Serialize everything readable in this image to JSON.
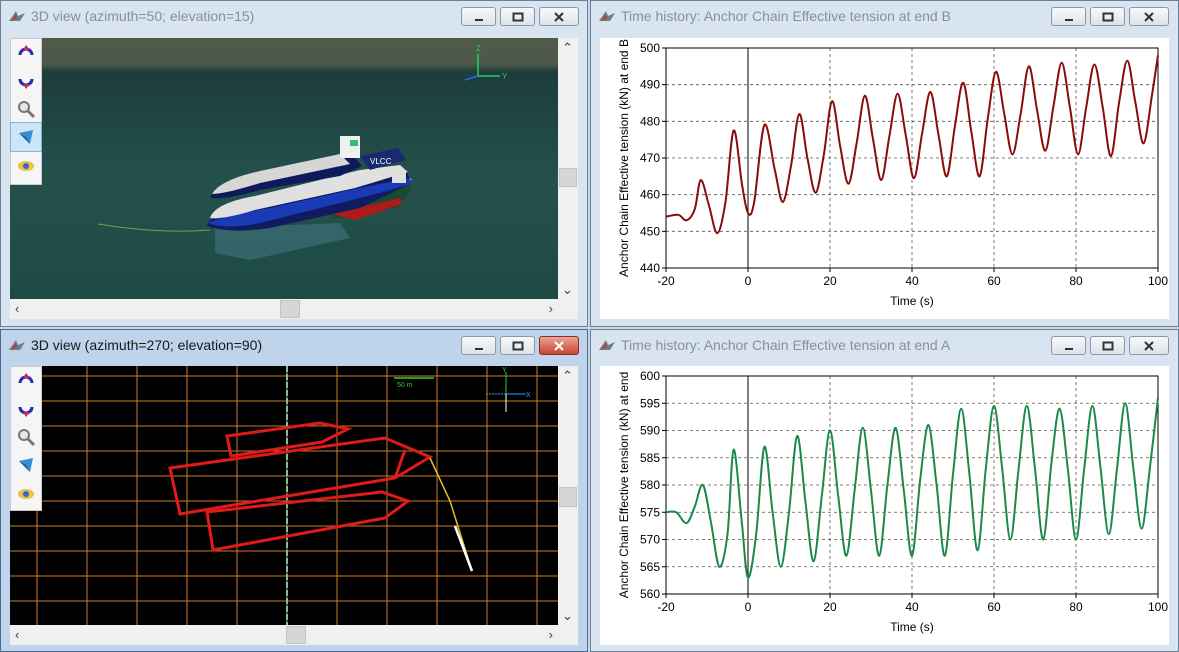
{
  "windows": {
    "view3d_top": {
      "title": "3D view (azimuth=50; elevation=15)",
      "axis_z": "Z",
      "axis_y": "Y",
      "vessel_label": "VLCC"
    },
    "chart_b": {
      "title": "Time history: Anchor Chain Effective tension at end B"
    },
    "view3d_bottom": {
      "title": "3D view (azimuth=270; elevation=90)",
      "scale_label": "50 m",
      "axis_y": "Y",
      "axis_x": "X"
    },
    "chart_a": {
      "title": "Time history: Anchor Chain Effective tension at end A"
    }
  },
  "toolbox": [
    "rotate-up-icon",
    "rotate-down-icon",
    "zoom-icon",
    "shade-icon",
    "view-icon"
  ],
  "colors": {
    "series_b": "#8b0a0a",
    "series_a": "#1a8a4a",
    "grid_3d": "#c87a2a",
    "vessel_outline": "#e01a1a"
  },
  "chart_data": [
    {
      "type": "line",
      "ylabel": "Anchor Chain Effective tension (kN) at end B",
      "xlabel": "Time (s)",
      "xlim": [
        -20,
        100
      ],
      "ylim": [
        440,
        500
      ],
      "xticks": [
        "-20",
        "0",
        "20",
        "40",
        "60",
        "80",
        "100"
      ],
      "yticks": [
        "440",
        "450",
        "460",
        "470",
        "480",
        "490",
        "500"
      ],
      "grid": true,
      "series": [
        {
          "x": [
            -20,
            -17,
            -15,
            -13,
            -11.5,
            -9.5,
            -7.5,
            -5.5,
            -3.5,
            -1.5,
            0,
            1.5,
            4,
            6.5,
            8.5,
            10.5,
            12.5,
            14.5,
            16.5,
            18.5,
            20.5,
            22.5,
            24.5,
            26.5,
            28.5,
            30.5,
            32.5,
            34.5,
            36.5,
            38.5,
            40.5,
            42.5,
            44.5,
            46.5,
            48.5,
            50.5,
            52.5,
            54.5,
            56.5,
            58.5,
            60.5,
            62.5,
            64.5,
            66.5,
            68.5,
            70.5,
            72.5,
            74.5,
            76.5,
            78.5,
            80.5,
            82.5,
            84.5,
            86.5,
            88.5,
            90.5,
            92.5,
            94.5,
            96.5,
            98.5,
            100
          ],
          "y": [
            454,
            454.5,
            453,
            456,
            464,
            457,
            449.5,
            458,
            477.5,
            463,
            455,
            458,
            479,
            467,
            458,
            468,
            482,
            470,
            460.5,
            471,
            485.5,
            473,
            463,
            474,
            487,
            475,
            464,
            476,
            487.5,
            476,
            464.5,
            477,
            488,
            476,
            465,
            479,
            490.5,
            477,
            465,
            481,
            493.5,
            482,
            471,
            482,
            495,
            483,
            472,
            484,
            496,
            484,
            471,
            484,
            495.5,
            484,
            470.5,
            485,
            496.5,
            485,
            474,
            487,
            498
          ]
        }
      ]
    },
    {
      "type": "line",
      "ylabel": "Anchor Chain Effective tension (kN) at end",
      "xlabel": "Time (s)",
      "xlim": [
        -20,
        100
      ],
      "ylim": [
        560,
        600
      ],
      "xticks": [
        "-20",
        "0",
        "20",
        "40",
        "60",
        "80",
        "100"
      ],
      "yticks": [
        "560",
        "565",
        "570",
        "575",
        "580",
        "585",
        "590",
        "595",
        "600"
      ],
      "grid": true,
      "series": [
        {
          "x": [
            -20,
            -17.5,
            -15,
            -13,
            -11,
            -9,
            -7,
            -5,
            -3.5,
            -1.5,
            0,
            2,
            4,
            6,
            8,
            10,
            12,
            14,
            16,
            18,
            20,
            22,
            24,
            26,
            28,
            30,
            32,
            34,
            36,
            38,
            40,
            42,
            44,
            46,
            48,
            50,
            52,
            54,
            56,
            58,
            60,
            62,
            64,
            66,
            68,
            70,
            72,
            74,
            76,
            78,
            80,
            82,
            84,
            86,
            88,
            90,
            92,
            94,
            96,
            98,
            100
          ],
          "y": [
            575,
            575,
            573,
            576,
            580,
            573,
            565,
            571,
            586.5,
            573,
            563,
            571,
            587,
            575,
            565,
            575,
            589,
            577,
            566,
            578,
            590,
            578,
            567,
            579,
            590.5,
            579,
            567,
            580,
            590.5,
            579,
            567,
            581,
            591,
            580,
            567,
            582,
            594,
            582,
            568,
            583,
            594.5,
            583,
            570,
            583,
            594.5,
            583,
            570,
            584,
            594,
            583,
            570,
            583,
            594.5,
            583,
            571,
            583,
            595,
            583,
            572,
            583,
            596
          ]
        }
      ]
    }
  ]
}
